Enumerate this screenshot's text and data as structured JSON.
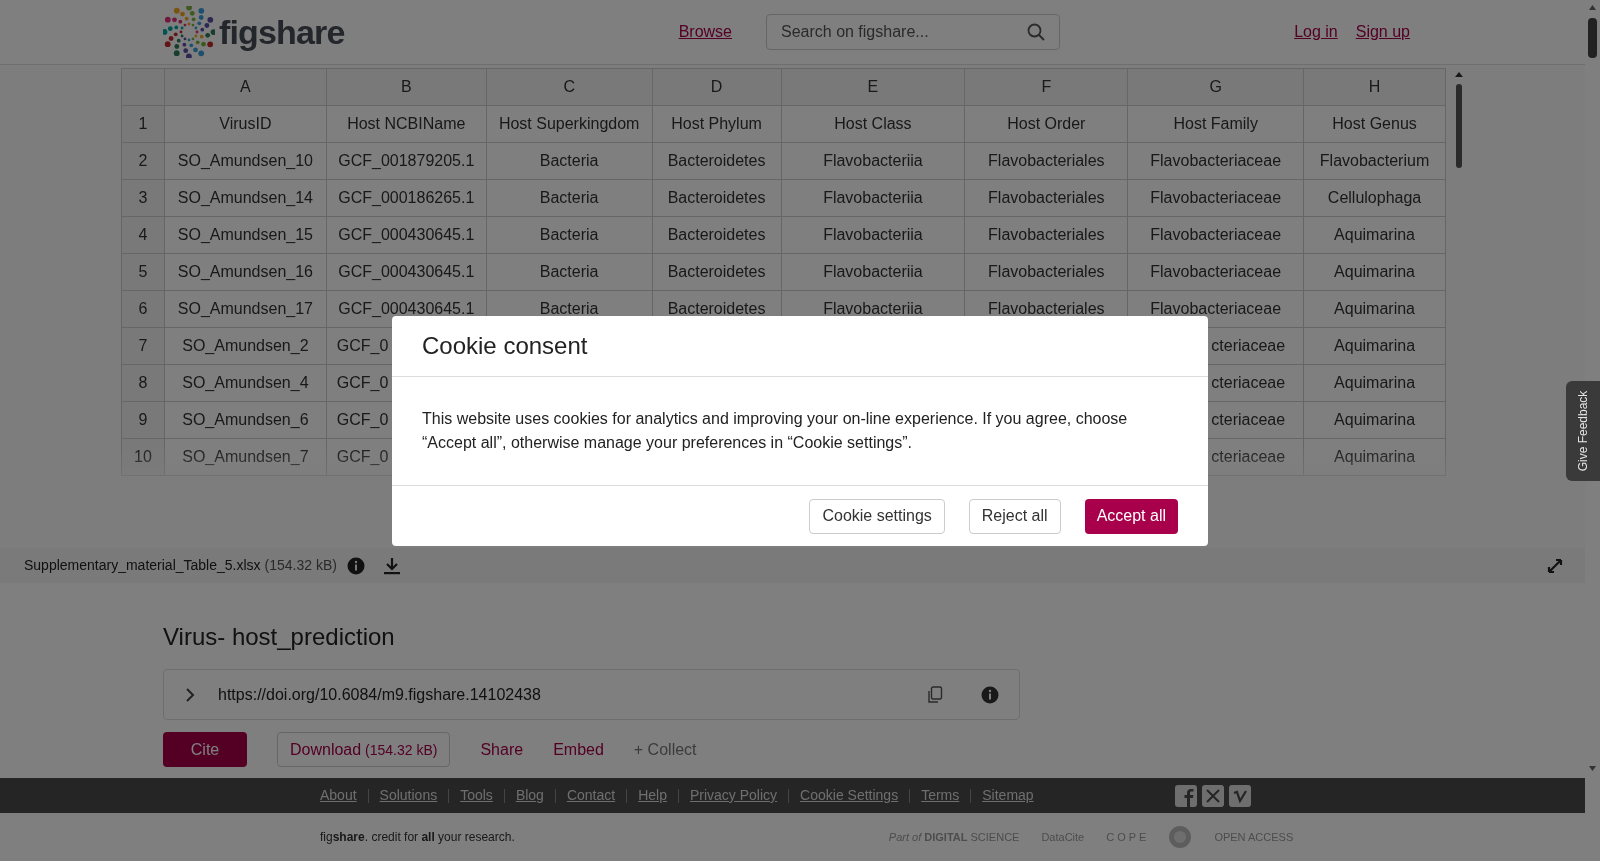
{
  "header": {
    "logo": "figshare",
    "nav": [
      "Browse"
    ],
    "search": {
      "placeholder": "Search on figshare..."
    },
    "auth": [
      "Log in",
      "Sign up"
    ]
  },
  "spreadsheet": {
    "columns": [
      "A",
      "B",
      "C",
      "D",
      "E",
      "F",
      "G",
      "H"
    ],
    "rows": [
      {
        "number": "1",
        "cells": [
          "VirusID",
          "Host NCBIName",
          "Host Superkingdom",
          "Host Phylum",
          "Host Class",
          "Host Order",
          "Host Family",
          "Host Genus"
        ]
      },
      {
        "number": "2",
        "cells": [
          "SO_Amundsen_10",
          "GCF_001879205.1",
          "Bacteria",
          "Bacteroidetes",
          "Flavobacteriia",
          "Flavobacteriales",
          "Flavobacteriaceae",
          "Flavobacterium"
        ]
      },
      {
        "number": "3",
        "cells": [
          "SO_Amundsen_14",
          "GCF_000186265.1",
          "Bacteria",
          "Bacteroidetes",
          "Flavobacteriia",
          "Flavobacteriales",
          "Flavobacteriaceae",
          "Cellulophaga"
        ]
      },
      {
        "number": "4",
        "cells": [
          "SO_Amundsen_15",
          "GCF_000430645.1",
          "Bacteria",
          "Bacteroidetes",
          "Flavobacteriia",
          "Flavobacteriales",
          "Flavobacteriaceae",
          "Aquimarina"
        ]
      },
      {
        "number": "5",
        "cells": [
          "SO_Amundsen_16",
          "GCF_000430645.1",
          "Bacteria",
          "Bacteroidetes",
          "Flavobacteriia",
          "Flavobacteriales",
          "Flavobacteriaceae",
          "Aquimarina"
        ]
      },
      {
        "number": "6",
        "cells": [
          "SO_Amundsen_17",
          "GCF_000430645.1",
          "Bacteria",
          "Bacteroidetes",
          "Flavobacteriia",
          "Flavobacteriales",
          "Flavobacteriaceae",
          "Aquimarina"
        ]
      },
      {
        "number": "7",
        "cells_left": [
          "SO_Amundsen_2",
          "GCF_0"
        ],
        "cells_right": [
          "cteriaceae",
          "Aquimarina"
        ]
      },
      {
        "number": "8",
        "cells_left": [
          "SO_Amundsen_4",
          "GCF_0"
        ],
        "cells_right": [
          "cteriaceae",
          "Aquimarina"
        ]
      },
      {
        "number": "9",
        "cells_left": [
          "SO_Amundsen_6",
          "GCF_0"
        ],
        "cells_right": [
          "cteriaceae",
          "Aquimarina"
        ]
      },
      {
        "number": "10",
        "cells_left": [
          "SO_Amundsen_7",
          "GCF_0"
        ],
        "cells_right": [
          "cteriaceae",
          "Aquimarina"
        ]
      }
    ]
  },
  "file_bar": {
    "filename": "Supplementary_material_Table_5.xlsx",
    "size": "(154.32 kB)"
  },
  "feedback_tab": "Give Feedback",
  "item": {
    "title": "Virus- host_prediction",
    "doi": "https://doi.org/10.6084/m9.figshare.14102438",
    "actions": [
      {
        "kind": "primary",
        "label": "Cite"
      },
      {
        "kind": "outline",
        "label": "Download",
        "note": "(154.32 kB)"
      },
      {
        "kind": "link",
        "label": "Share"
      },
      {
        "kind": "link",
        "label": "Embed"
      },
      {
        "kind": "muted",
        "label": "+ Collect"
      }
    ]
  },
  "footer": {
    "links": [
      "About",
      "Solutions",
      "Tools",
      "Blog",
      "Contact",
      "Help",
      "Privacy Policy",
      "Cookie Settings",
      "Terms",
      "Sitemap"
    ],
    "tagline": "fig**share**. credit for **all** your research.",
    "partners": [
      "*Part of* **DIGITAL** SCIENCE",
      "DataCite",
      "C O P E",
      "OPEN ACCESS"
    ]
  },
  "cookie_dialog": {
    "title": "Cookie consent",
    "message": "This website uses cookies for analytics and improving your on-line experience. If you agree, choose “Accept all”, otherwise manage your preferences in “Cookie settings”.",
    "buttons": [
      {
        "kind": "secondary",
        "label": "Cookie settings"
      },
      {
        "kind": "secondary",
        "label": "Reject all"
      },
      {
        "kind": "primary",
        "label": "Accept all"
      }
    ]
  }
}
